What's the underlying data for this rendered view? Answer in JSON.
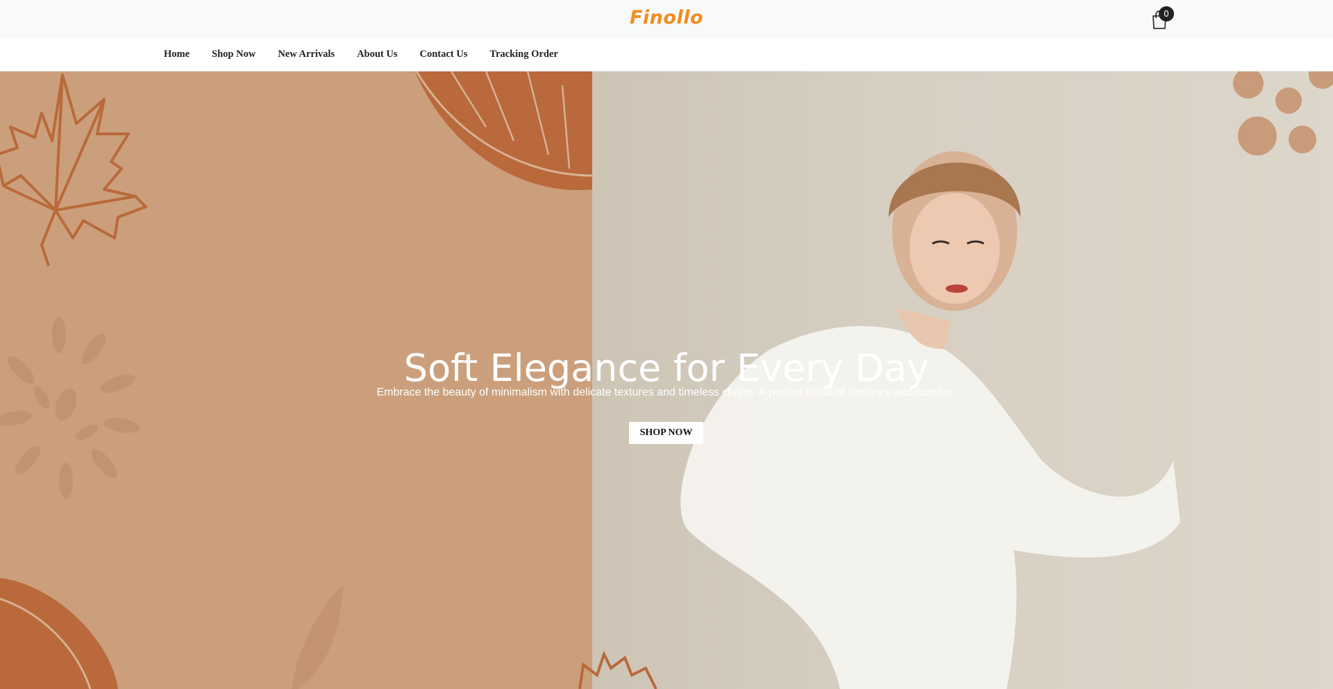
{
  "brand": {
    "logo_text": "Finollo",
    "logo_color": "#f28c1e"
  },
  "cart": {
    "icon": "shopping-bag-icon",
    "count": "0"
  },
  "nav": {
    "items": [
      {
        "label": "Home"
      },
      {
        "label": "Shop Now"
      },
      {
        "label": "New Arrivals"
      },
      {
        "label": "About Us"
      },
      {
        "label": "Contact Us"
      },
      {
        "label": "Tracking Order"
      }
    ]
  },
  "hero": {
    "title": "Soft Elegance for Every Day",
    "subtitle": "Embrace the beauty of minimalism with delicate textures and timeless charm. A perfect blend of romance and comfort.",
    "button_label": "SHOP NOW",
    "left_panel_color": "#cb9f7b",
    "leaf_color": "#b9693b",
    "right_panel_color": "#d6cfc2"
  }
}
